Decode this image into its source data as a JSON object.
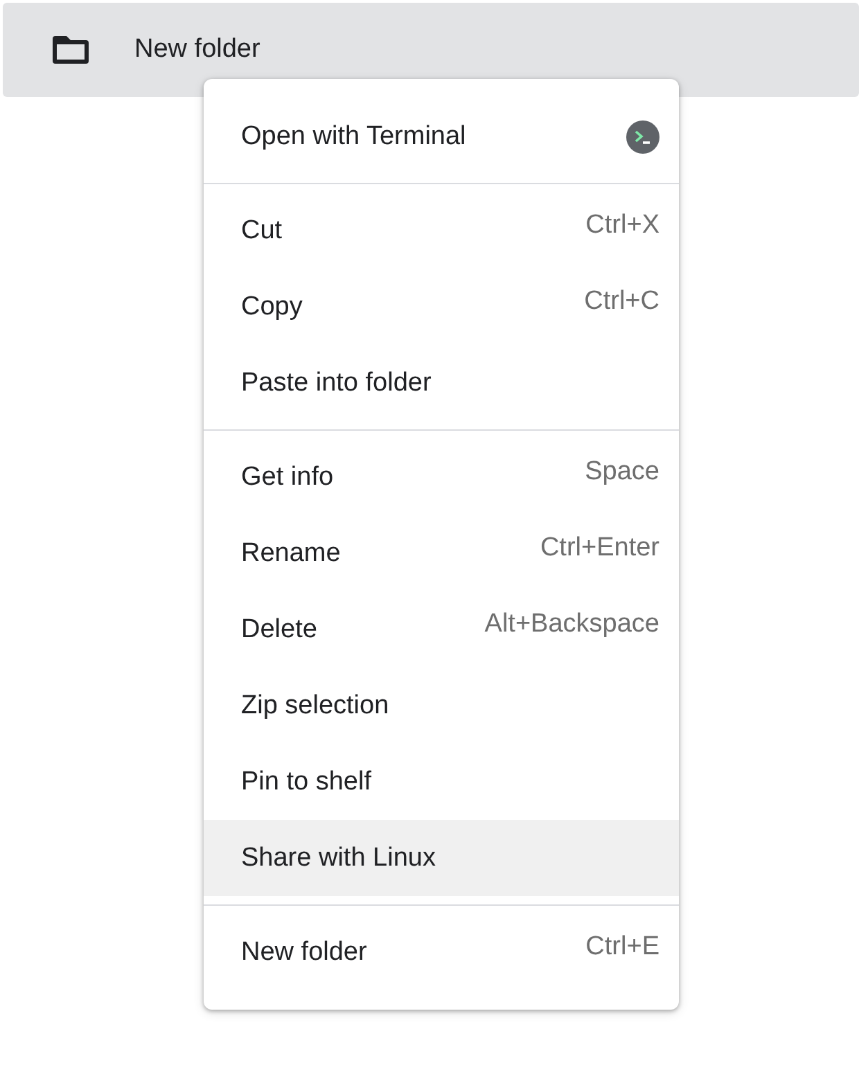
{
  "file_row": {
    "name": "New folder",
    "selected": true
  },
  "menu": {
    "groups": [
      {
        "items": [
          {
            "label": "Open with Terminal",
            "kind": "terminal",
            "selected": false
          }
        ]
      },
      {
        "items": [
          {
            "label": "Cut",
            "shortcut": "Ctrl+X",
            "selected": false
          },
          {
            "label": "Copy",
            "shortcut": "Ctrl+C",
            "selected": false
          },
          {
            "label": "Paste into folder",
            "selected": false
          }
        ]
      },
      {
        "items": [
          {
            "label": "Get info",
            "shortcut": "Space",
            "selected": false
          },
          {
            "label": "Rename",
            "shortcut": "Ctrl+Enter",
            "selected": false
          },
          {
            "label": "Delete",
            "shortcut": "Alt+Backspace",
            "selected": false
          },
          {
            "label": "Zip selection",
            "selected": false
          },
          {
            "label": "Pin to shelf",
            "selected": false
          },
          {
            "label": "Share with Linux",
            "selected": true
          }
        ]
      },
      {
        "items": [
          {
            "label": "New folder",
            "shortcut": "Ctrl+E",
            "selected": false
          }
        ]
      }
    ]
  }
}
